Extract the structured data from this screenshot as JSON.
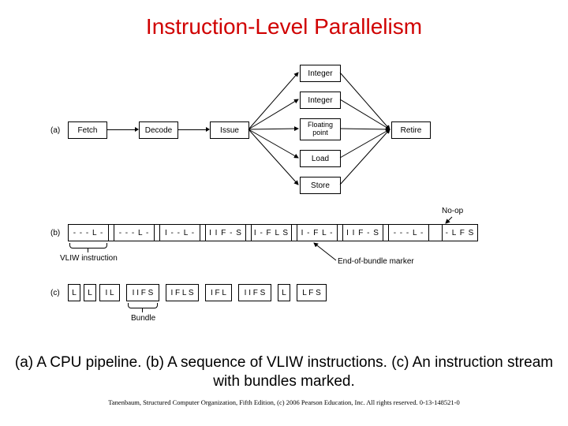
{
  "title": "Instruction-Level Parallelism",
  "part_labels": {
    "a": "(a)",
    "b": "(b)",
    "c": "(c)"
  },
  "pipeline": {
    "stages": [
      "Fetch",
      "Decode",
      "Issue",
      "Retire"
    ],
    "units": [
      "Integer",
      "Integer",
      "Floating point",
      "Load",
      "Store"
    ],
    "noop_label": "No-op"
  },
  "vliw_sequence": {
    "cells": [
      "- - - L -",
      "- - - L -",
      "I - - L -",
      "I I F - S",
      "I - F L S",
      "I - F L -",
      "I I F - S",
      "- - - L -",
      "- L F S"
    ],
    "brace_label": "VLIW instruction",
    "end_marker_label": "End-of-bundle marker"
  },
  "bundle_stream": {
    "cells": [
      "L",
      "L",
      "I L",
      "I I F S",
      "I F L S",
      "I F L",
      "I I F S",
      "L",
      "L F S"
    ],
    "brace_label": "Bundle"
  },
  "caption": "(a) A CPU pipeline. (b) A sequence of VLIW instructions. (c) An instruction stream with bundles marked.",
  "copyright": "Tanenbaum, Structured Computer Organization, Fifth Edition, (c) 2006 Pearson Education, Inc. All rights reserved. 0-13-148521-0"
}
